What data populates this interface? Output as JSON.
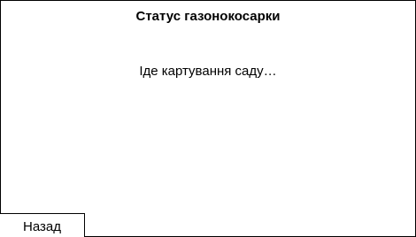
{
  "screen": {
    "title": "Статус газонокосарки",
    "status_message": "Іде картування саду…"
  },
  "footer": {
    "back_label": "Назад"
  }
}
